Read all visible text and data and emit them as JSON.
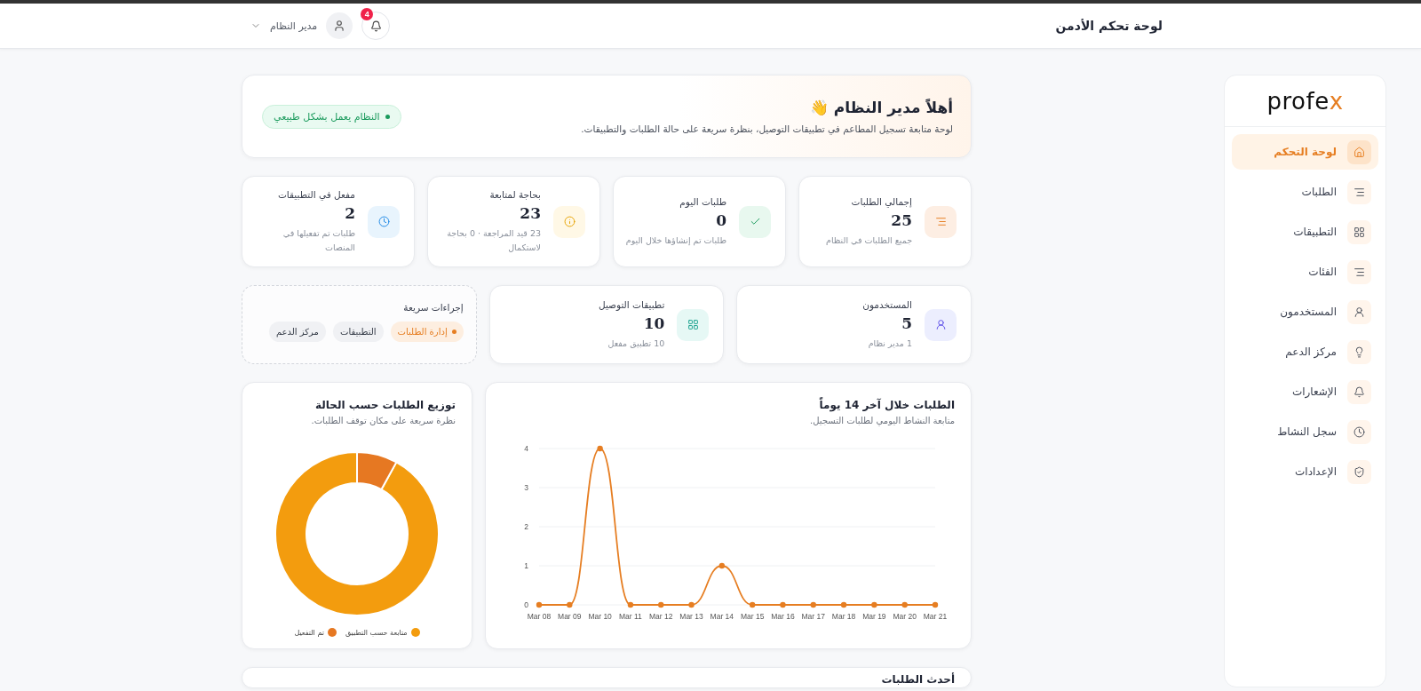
{
  "header": {
    "title": "لوحة تحكم الأدمن",
    "user_name": "مدير النظام",
    "notification_count": "4"
  },
  "sidebar": {
    "logo": {
      "main": "profe",
      "accent": "x"
    },
    "items": [
      {
        "label": "لوحة التحكم",
        "kind": "home",
        "selected": true
      },
      {
        "label": "الطلبات",
        "kind": "list",
        "selected": false
      },
      {
        "label": "التطبيقات",
        "kind": "grid",
        "selected": false
      },
      {
        "label": "الفئات",
        "kind": "list",
        "selected": false
      },
      {
        "label": "المستخدمون",
        "kind": "user",
        "selected": false
      },
      {
        "label": "مركز الدعم",
        "kind": "bulb",
        "selected": false
      },
      {
        "label": "الإشعارات",
        "kind": "bell",
        "selected": false
      },
      {
        "label": "سجل النشاط",
        "kind": "clock",
        "selected": false
      },
      {
        "label": "الإعدادات",
        "kind": "shield",
        "selected": false
      }
    ]
  },
  "welcome": {
    "title": "أهلاً مدير النظام 👋",
    "subtitle": "لوحة متابعة تسجيل المطاعم في تطبيقات التوصيل، بنظرة سريعة على حالة الطلبات والتطبيقات.",
    "status": "النظام يعمل بشكل طبيعي"
  },
  "stats": [
    {
      "label": "إجمالي الطلبات",
      "value": "25",
      "note": "جميع الطلبات في النظام",
      "kind": "list"
    },
    {
      "label": "طلبات اليوم",
      "value": "0",
      "note": "طلبات تم إنشاؤها خلال اليوم",
      "kind": "check"
    },
    {
      "label": "بحاجة لمتابعة",
      "value": "23",
      "note": "23 قيد المراجعة · 0 بحاجة لاستكمال",
      "kind": "info"
    },
    {
      "label": "مفعل في التطبيقات",
      "value": "2",
      "note": "طلبات تم تفعيلها في المنصات",
      "kind": "clock"
    }
  ],
  "summary": [
    {
      "label": "المستخدمون",
      "value": "5",
      "note": "1 مدير نظام",
      "kind": "user"
    },
    {
      "label": "تطبيقات التوصيل",
      "value": "10",
      "note": "10 تطبيق مفعل",
      "kind": "grid"
    }
  ],
  "quick_actions": {
    "title": "إجراءات سريعة",
    "items": [
      {
        "label": "إدارة الطلبات",
        "selected": true
      },
      {
        "label": "التطبيقات",
        "selected": false
      },
      {
        "label": "مركز الدعم",
        "selected": false
      }
    ]
  },
  "line_card": {
    "subtitle": "متابعة النشاط اليومي لطلبات التسجيل.",
    "chart_data": {
      "type": "line",
      "grid": true,
      "title": "الطلبات خلال آخر 14 يوماً",
      "categories": [
        "Mar 08",
        "Mar 09",
        "Mar 10",
        "Mar 11",
        "Mar 12",
        "Mar 13",
        "Mar 14",
        "Mar 15",
        "Mar 16",
        "Mar 17",
        "Mar 18",
        "Mar 19",
        "Mar 20",
        "Mar 21"
      ],
      "series": [
        {
          "color": "#e67e22",
          "marker": "circle",
          "values": [
            0,
            0,
            4,
            0,
            0,
            0,
            1,
            0,
            0,
            0,
            0,
            0,
            0,
            0
          ]
        }
      ],
      "ylim": [
        0,
        4
      ],
      "yticks": [
        0,
        1,
        2,
        3,
        4
      ]
    }
  },
  "donut_card": {
    "subtitle": "نظرة سريعة على مكان توقف الطلبات.",
    "chart_data": {
      "type": "donut",
      "title": "توزيع الطلبات حسب الحالة",
      "categories": [
        "متابعة حسب التطبيق",
        "تم التفعيل"
      ],
      "values": [
        92,
        8
      ],
      "colors": [
        "#f39c0e",
        "#e67822"
      ]
    }
  },
  "latest": {
    "title": "أحدث الطلبات"
  }
}
